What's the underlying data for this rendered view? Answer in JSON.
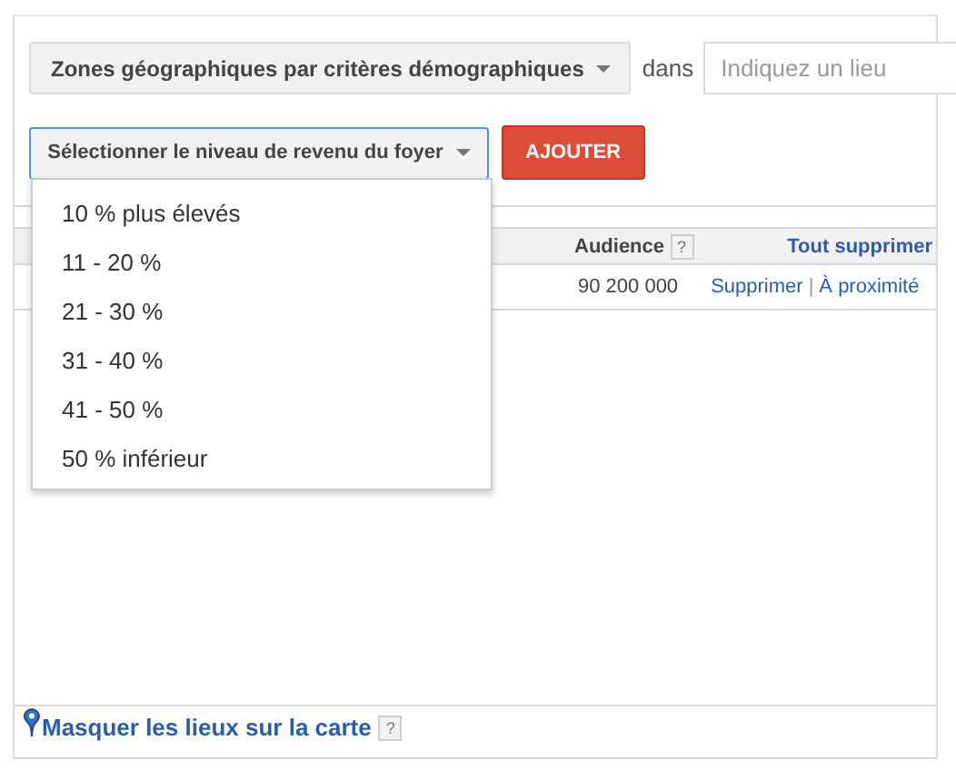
{
  "zone_dropdown": {
    "label": "Zones géographiques par critères démographiques"
  },
  "in_label": "dans",
  "location_field": {
    "placeholder": "Indiquez un lieu"
  },
  "income_dropdown": {
    "label": "Sélectionner le niveau de revenu du foyer",
    "expanded": true
  },
  "add_button": "AJOUTER",
  "income_options": [
    {
      "label": "10 % plus élevés"
    },
    {
      "label": "11 - 20 %"
    },
    {
      "label": "21 - 30 %"
    },
    {
      "label": "31 - 40 %"
    },
    {
      "label": "41 - 50 %"
    },
    {
      "label": "50 % inférieur"
    }
  ],
  "table": {
    "audience_header": "Audience",
    "help_mark": "?",
    "remove_all": "Tout supprimer",
    "rows": [
      {
        "audience": "90 200 000",
        "remove": "Supprimer",
        "separator": "|",
        "nearby": "À proximité"
      }
    ]
  },
  "footer": {
    "link": "Masquer les lieux sur la carte",
    "help_mark": "?"
  }
}
